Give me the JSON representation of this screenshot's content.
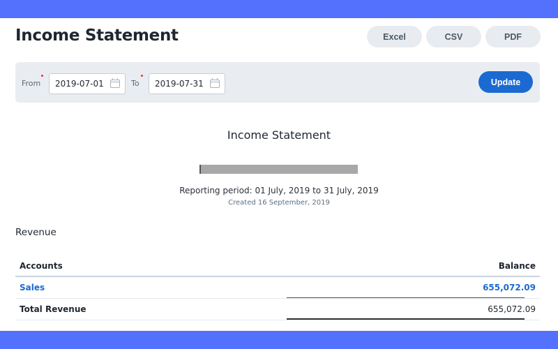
{
  "header": {
    "title": "Income Statement",
    "export_buttons": [
      {
        "label": "Excel"
      },
      {
        "label": "CSV"
      },
      {
        "label": "PDF"
      }
    ]
  },
  "filters": {
    "from_label": "From",
    "from_value": "2019-07-01",
    "to_label": "To",
    "to_value": "2019-07-31",
    "update_label": "Update",
    "required_color": "#e0343c"
  },
  "report": {
    "title": "Income Statement",
    "company_name": "[redacted]",
    "period": "Reporting period: 01 July, 2019 to 31 July, 2019",
    "created": "Created 16 September, 2019"
  },
  "revenue": {
    "section_title": "Revenue",
    "columns": [
      "Accounts",
      "Balance"
    ],
    "rows": [
      {
        "account": "Sales",
        "balance": "655,072.09"
      }
    ],
    "total": {
      "label": "Total Revenue",
      "balance": "655,072.09"
    }
  },
  "colors": {
    "brand_band": "#5471fd",
    "accent": "#1b6ad2",
    "filter_bg": "#e9edf1"
  }
}
